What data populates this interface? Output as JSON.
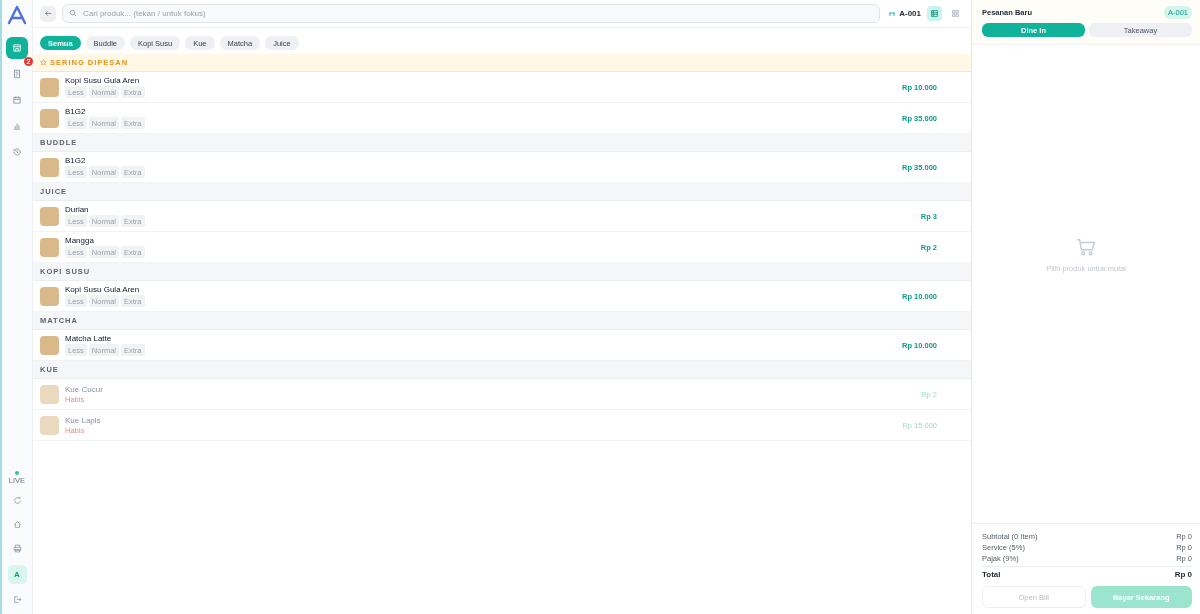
{
  "sidebar": {
    "items": [
      {
        "kind": "store",
        "selected": true
      },
      {
        "kind": "orders",
        "selected": false,
        "badge": "2"
      },
      {
        "kind": "calendar",
        "selected": false
      },
      {
        "kind": "chart",
        "selected": false
      },
      {
        "kind": "history",
        "selected": false
      }
    ],
    "status": "LIVE",
    "bottom": [
      {
        "kind": "refresh"
      },
      {
        "kind": "home"
      },
      {
        "kind": "print"
      },
      {
        "kind": "avatar",
        "label": "A"
      },
      {
        "kind": "logout"
      }
    ]
  },
  "search": {
    "placeholder": "Cari produk... (tekan / untuk fokus)"
  },
  "table_label": "A-001",
  "view_modes": [
    {
      "kind": "list",
      "selected": true
    },
    {
      "kind": "grid",
      "selected": false
    }
  ],
  "categories": [
    {
      "label": "Semua",
      "selected": true
    },
    {
      "label": "Buddle",
      "selected": false
    },
    {
      "label": "Kopi Susu",
      "selected": false
    },
    {
      "label": "Kue",
      "selected": false
    },
    {
      "label": "Matcha",
      "selected": false
    },
    {
      "label": "Juice",
      "selected": false
    }
  ],
  "sections": [
    {
      "kind": "featured",
      "title": "SERING DIPESAN",
      "items": [
        {
          "name": "Kopi Susu Gula Aren",
          "price": "Rp 10.000",
          "options": [
            "Less",
            "Normal",
            "Extra"
          ],
          "sold_out": false
        },
        {
          "name": "B1G2",
          "price": "Rp 35.000",
          "options": [
            "Less",
            "Normal",
            "Extra"
          ],
          "sold_out": false
        }
      ]
    },
    {
      "kind": "category",
      "title": "BUDDLE",
      "items": [
        {
          "name": "B1G2",
          "price": "Rp 35.000",
          "options": [
            "Less",
            "Normal",
            "Extra"
          ],
          "sold_out": false
        }
      ]
    },
    {
      "kind": "category",
      "title": "JUICE",
      "items": [
        {
          "name": "Durian",
          "price": "Rp 3",
          "options": [
            "Less",
            "Normal",
            "Extra"
          ],
          "sold_out": false
        },
        {
          "name": "Mangga",
          "price": "Rp 2",
          "options": [
            "Less",
            "Normal",
            "Extra"
          ],
          "sold_out": false
        }
      ]
    },
    {
      "kind": "category",
      "title": "KOPI SUSU",
      "items": [
        {
          "name": "Kopi Susu Gula Aren",
          "price": "Rp 10.000",
          "options": [
            "Less",
            "Normal",
            "Extra"
          ],
          "sold_out": false
        }
      ]
    },
    {
      "kind": "category",
      "title": "MATCHA",
      "items": [
        {
          "name": "Matcha Latte",
          "price": "Rp 10.000",
          "options": [
            "Less",
            "Normal",
            "Extra"
          ],
          "sold_out": false
        }
      ]
    },
    {
      "kind": "category",
      "title": "KUE",
      "items": [
        {
          "name": "Kue Cucur",
          "price": "Rp 2",
          "status": "Habis",
          "sold_out": true
        },
        {
          "name": "Kue Lapis",
          "price": "Rp 15.000",
          "status": "Habis",
          "sold_out": true
        }
      ]
    }
  ],
  "order": {
    "title": "Pesanan Baru",
    "number": "A-001",
    "modes": [
      {
        "label": "Dine In",
        "selected": true
      },
      {
        "label": "Takeaway",
        "selected": false
      }
    ],
    "empty_message": "Pilih produk untuk mulai",
    "summary": [
      {
        "label": "Subtotal (0 Item)",
        "value": "Rp 0"
      },
      {
        "label": "Service (5%)",
        "value": "Rp 0"
      },
      {
        "label": "Pajak (9%)",
        "value": "Rp 0"
      }
    ],
    "total": {
      "label": "Total",
      "value": "Rp 0"
    },
    "actions": [
      {
        "label": "Open Bill",
        "kind": "secondary",
        "disabled": true
      },
      {
        "label": "Bayar Sekarang",
        "kind": "primary",
        "disabled": true
      }
    ]
  }
}
